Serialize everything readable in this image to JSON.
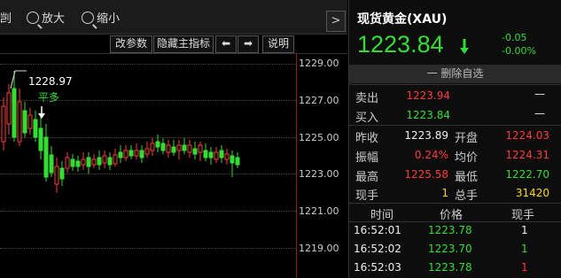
{
  "toolbar": {
    "cut_label": "剀",
    "zoom_in_label": "放大",
    "zoom_out_label": "缩小",
    "nav_arrow": ">"
  },
  "toolbar2": {
    "params_label": "改参数",
    "hide_indicator_label": "隐藏主指标",
    "left_arrow": "⬅",
    "right_arrow": "➡",
    "help_label": "说明"
  },
  "chart": {
    "y_ticks": [
      "1229.00",
      "1227.00",
      "1225.00",
      "1223.00",
      "1221.00",
      "1219.00"
    ],
    "high_label": "1228.97",
    "annotation": "平多"
  },
  "quote": {
    "title": "现货黄金(XAU)",
    "price": "1223.84",
    "change": "-0.05",
    "change_pct": "-0.00%",
    "delete_label": "一 删除自选",
    "colors": {
      "up": "#ff3b3b",
      "down": "#33dd33",
      "volume": "#ffd700"
    }
  },
  "book": [
    {
      "label": "卖出",
      "value": "1223.94",
      "vol": "—"
    },
    {
      "label": "买入",
      "value": "1223.84",
      "vol": "—"
    }
  ],
  "stats": [
    {
      "l1": "昨收",
      "v1": "1223.89",
      "l2": "开盘",
      "v2": "1224.03"
    },
    {
      "l1": "振幅",
      "v1": "0.24%",
      "l2": "均价",
      "v2": "1224.31"
    },
    {
      "l1": "最高",
      "v1": "1225.58",
      "l2": "最低",
      "v2": "1222.70"
    },
    {
      "l1": "现手",
      "v1": "1",
      "l2": "总手",
      "v2": "31420"
    }
  ],
  "ticks": {
    "headers": [
      "时间",
      "价格",
      "现手"
    ],
    "rows": [
      {
        "time": "16:52:01",
        "price": "1223.78",
        "vol": "1"
      },
      {
        "time": "16:52:02",
        "price": "1223.70",
        "vol": "1"
      },
      {
        "time": "16:52:03",
        "price": "1223.78",
        "vol": "1"
      }
    ]
  }
}
